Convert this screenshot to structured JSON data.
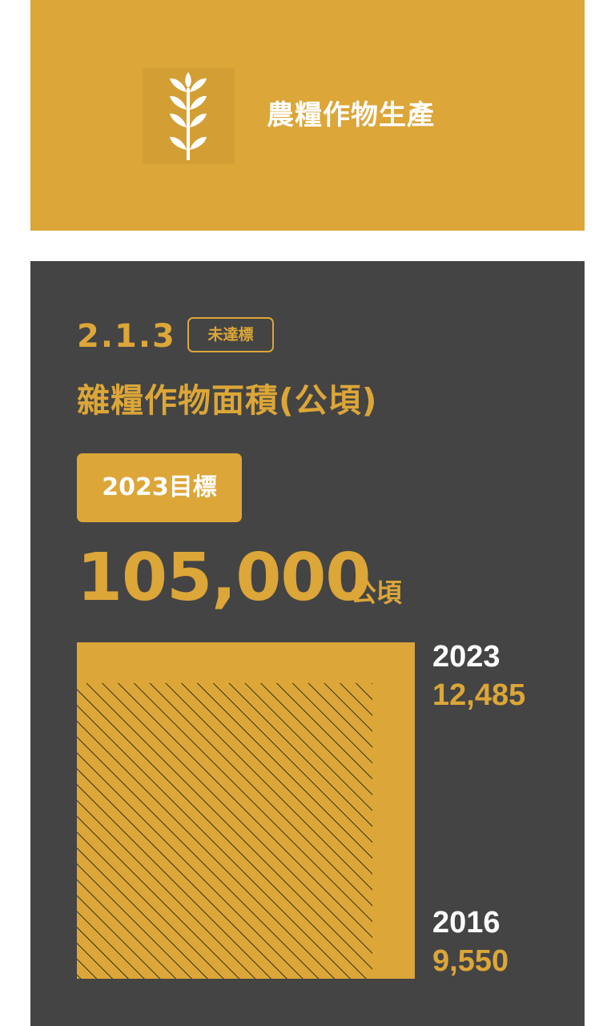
{
  "header": {
    "title": "農糧作物生產",
    "icon": "wheat-icon",
    "background_color": "#dca638"
  },
  "indicator": {
    "code": "2.1.3",
    "status": "未達標",
    "title": "雜糧作物面積(公頃)",
    "target_label": "2023目標",
    "target_value": "105,000",
    "target_unit": "公頃"
  },
  "chart_data": {
    "type": "area",
    "target": 105000,
    "series": [
      {
        "year": "2023",
        "value": 12485,
        "value_label": "12,485"
      },
      {
        "year": "2016",
        "value": 9550,
        "value_label": "9,550"
      }
    ],
    "colors": {
      "accent": "#dca638",
      "card": "#444444",
      "hatch": "#000000"
    }
  }
}
